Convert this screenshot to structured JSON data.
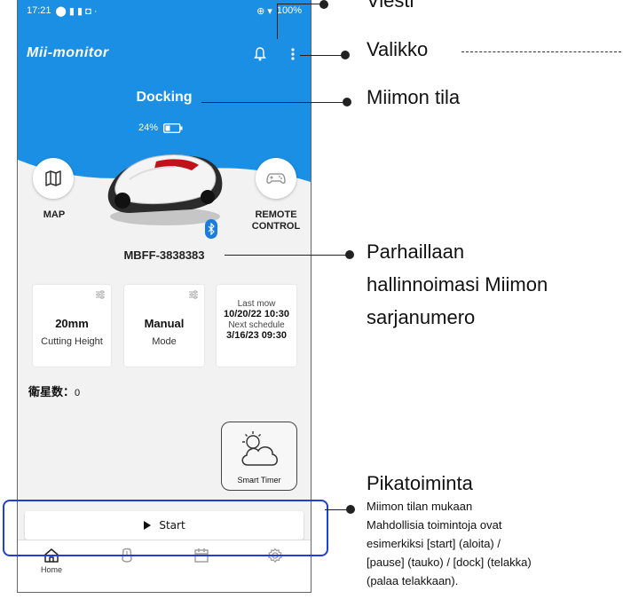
{
  "status_bar": {
    "time": "17:21",
    "battery": "100%"
  },
  "app": {
    "logo": "Mii-monitor"
  },
  "mower": {
    "state": "Docking",
    "battery": "24%",
    "serial": "MBFF-3838383"
  },
  "buttons": {
    "map": "MAP",
    "remote_control_line1": "REMOTE",
    "remote_control_line2": "CONTROL"
  },
  "cards": {
    "cutting_height": {
      "value": "20mm",
      "label": "Cutting Height"
    },
    "mode": {
      "value": "Manual",
      "label": "Mode"
    },
    "schedule": {
      "last_mow_label": "Last mow",
      "last_mow_value": "10/20/22 10:30",
      "next_schedule_label": "Next schedule",
      "next_schedule_value": "3/16/23 09:30"
    }
  },
  "satellites": {
    "label": "衛星数：",
    "value": "0"
  },
  "smart_timer": {
    "label": "Smart Timer"
  },
  "quick_action": {
    "label": "Start"
  },
  "nav": {
    "home": "Home"
  },
  "annotations": {
    "message": "Viesti",
    "menu": "Valikko",
    "state": "Miimon tila",
    "serial_1": "Parhaillaan",
    "serial_2": "hallinnoimasi Miimon",
    "serial_3": "sarjanumero",
    "quick_title": "Pikatoiminta",
    "quick_1": "Miimon tilan mukaan",
    "quick_2": "Mahdollisia toimintoja ovat",
    "quick_3": "esimerkiksi [start] (aloita) /",
    "quick_4": "[pause] (tauko) / [dock] (telakka)",
    "quick_5": "(palaa telakkaan)."
  },
  "colors": {
    "primary_blue": "#1a8fe3",
    "highlight_border": "#1f3fd6"
  }
}
